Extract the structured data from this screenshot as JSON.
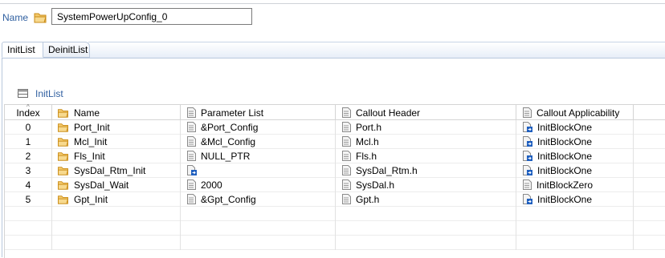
{
  "header": {
    "name_label": "Name",
    "name_value": "SystemPowerUpConfig_0"
  },
  "tabs": [
    {
      "label": "InitList",
      "active": true
    },
    {
      "label": "DeinitList",
      "active": false
    }
  ],
  "section": {
    "title": "InitList"
  },
  "table": {
    "columns": [
      "Index",
      "Name",
      "Parameter List",
      "Callout Header",
      "Callout Applicability"
    ],
    "rows": [
      {
        "index": "0",
        "name": "Port_Init",
        "param": "&Port_Config",
        "header": "Port.h",
        "app": "InitBlockOne",
        "param_icon": "file-icon",
        "app_icon": "ref-file-icon"
      },
      {
        "index": "1",
        "name": "Mcl_Init",
        "param": "&Mcl_Config",
        "header": "Mcl.h",
        "app": "InitBlockOne",
        "param_icon": "file-icon",
        "app_icon": "ref-file-icon"
      },
      {
        "index": "2",
        "name": "Fls_Init",
        "param": "NULL_PTR",
        "header": "Fls.h",
        "app": "InitBlockOne",
        "param_icon": "file-icon",
        "app_icon": "ref-file-icon"
      },
      {
        "index": "3",
        "name": "SysDal_Rtm_Init",
        "param": "",
        "header": "SysDal_Rtm.h",
        "app": "InitBlockOne",
        "param_icon": "ref-file-icon",
        "app_icon": "ref-file-icon"
      },
      {
        "index": "4",
        "name": "SysDal_Wait",
        "param": "2000",
        "header": "SysDal.h",
        "app": "InitBlockZero",
        "param_icon": "file-icon",
        "app_icon": "file-icon"
      },
      {
        "index": "5",
        "name": "Gpt_Init",
        "param": "&Gpt_Config",
        "header": "Gpt.h",
        "app": "InitBlockOne",
        "param_icon": "file-icon",
        "app_icon": "ref-file-icon"
      }
    ]
  },
  "colors": {
    "accent_text": "#2f5fa0",
    "folder": "#e3a52a",
    "ref_badge": "#1f5fbf"
  }
}
